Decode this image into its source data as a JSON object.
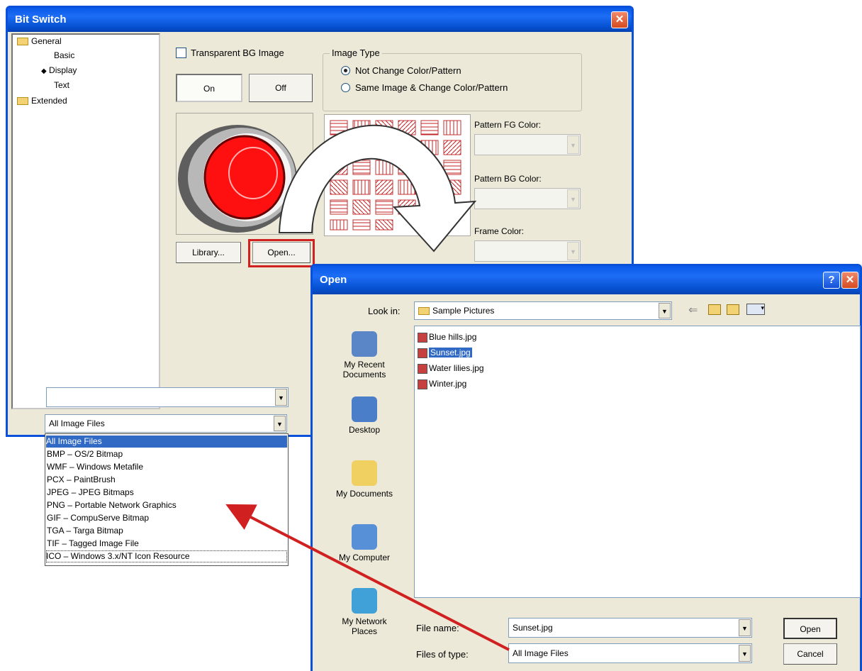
{
  "bit_switch": {
    "title": "Bit Switch",
    "tree": {
      "general": "General",
      "basic": "Basic",
      "display": "Display",
      "text": "Text",
      "extended": "Extended"
    },
    "transparent_bg_label": "Transparent BG Image",
    "image_type": {
      "label": "Image Type",
      "option1": "Not Change Color/Pattern",
      "option2": "Same Image & Change Color/Pattern"
    },
    "on_label": "On",
    "off_label": "Off",
    "library_label": "Library...",
    "open_label": "Open...",
    "pattern_fg_label": "Pattern FG Color:",
    "pattern_bg_label": "Pattern BG Color:",
    "frame_color_label": "Frame Color:"
  },
  "file_type_combo": {
    "value": "All Image Files",
    "options": [
      "All Image Files",
      "BMP – OS/2 Bitmap",
      "WMF – Windows Metafile",
      "PCX – PaintBrush",
      "JPEG – JPEG Bitmaps",
      "PNG – Portable Network Graphics",
      "GIF – CompuServe Bitmap",
      "TGA – Targa Bitmap",
      "TIF – Tagged Image File",
      "ICO – Windows 3.x/NT Icon Resource"
    ]
  },
  "open_dialog": {
    "title": "Open",
    "help_glyph": "?",
    "close_glyph": "✕",
    "look_in_label": "Look in:",
    "look_in_value": "Sample Pictures",
    "places": {
      "recent": "My Recent Documents",
      "desktop": "Desktop",
      "documents": "My Documents",
      "computer": "My Computer",
      "network": "My Network Places"
    },
    "files": [
      "Blue hills.jpg",
      "Sunset.jpg",
      "Water lilies.jpg",
      "Winter.jpg"
    ],
    "file_name_label": "File name:",
    "file_name_value": "Sunset.jpg",
    "files_of_type_label": "Files of type:",
    "files_of_type_value": "All Image Files",
    "open_button": "Open",
    "cancel_button": "Cancel"
  },
  "colors": {
    "title_blue": "#0a58e8",
    "selection": "#316ac5",
    "annotation_red": "#d02020"
  }
}
